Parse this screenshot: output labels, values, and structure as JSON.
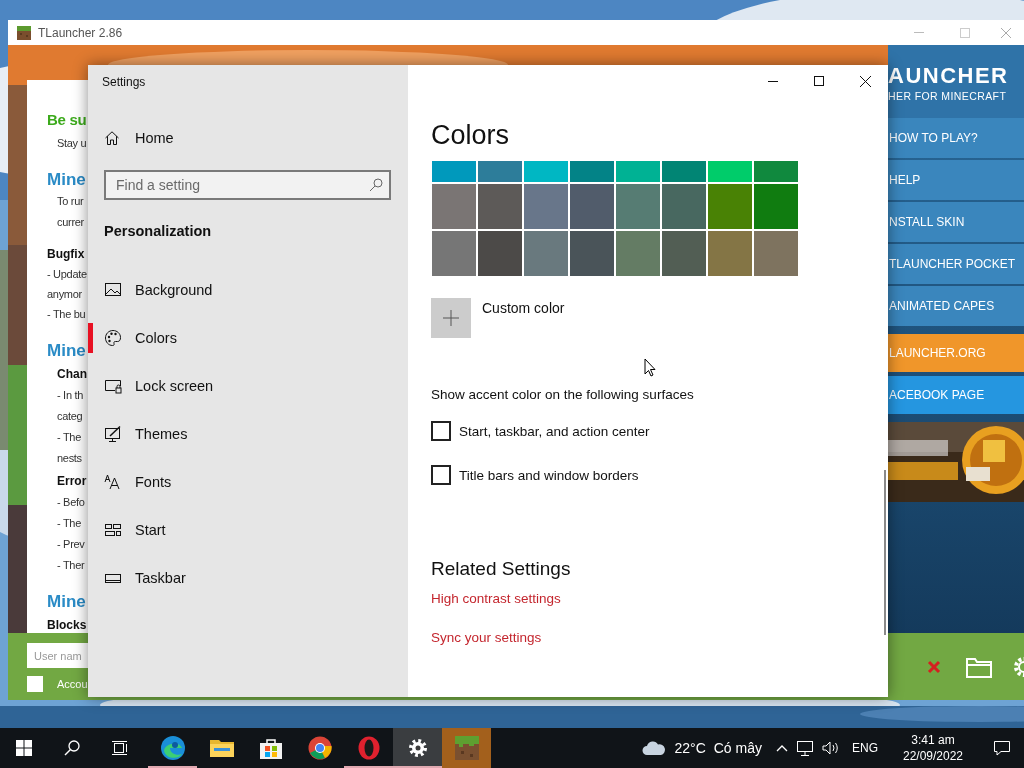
{
  "tlauncher": {
    "title": "TLauncher 2.86",
    "news": [
      {
        "kind": "title",
        "text": "Be su"
      },
      {
        "kind": "subline",
        "text": "Stay u"
      },
      {
        "kind": "heading",
        "text": "Mine"
      },
      {
        "kind": "subline",
        "text": "To rur"
      },
      {
        "kind": "subline",
        "text": "currer"
      },
      {
        "kind": "label",
        "text": "Bugfix"
      },
      {
        "kind": "line",
        "text": "- Update"
      },
      {
        "kind": "line",
        "text": "anymor"
      },
      {
        "kind": "line",
        "text": "- The bu"
      },
      {
        "kind": "heading",
        "text": "Mine"
      },
      {
        "kind": "sublabel",
        "text": "Chan"
      },
      {
        "kind": "subline",
        "text": "- In th"
      },
      {
        "kind": "subline",
        "text": "categ"
      },
      {
        "kind": "subline",
        "text": "- The"
      },
      {
        "kind": "subline",
        "text": "nests"
      },
      {
        "kind": "sublabel",
        "text": "Error"
      },
      {
        "kind": "subline",
        "text": "- Befo"
      },
      {
        "kind": "subline",
        "text": "- The"
      },
      {
        "kind": "subline",
        "text": "- Prev"
      },
      {
        "kind": "subline",
        "text": "- Ther"
      },
      {
        "kind": "heading",
        "text": "Mine"
      },
      {
        "kind": "label",
        "text": "Blocks"
      }
    ],
    "brand": {
      "title": "AUNCHER",
      "subtitle": "HER FOR MINECRAFT"
    },
    "menu": [
      {
        "kind": "menu",
        "label": "HOW TO PLAY?"
      },
      {
        "kind": "menu",
        "label": "HELP"
      },
      {
        "kind": "menu",
        "label": "NSTALL SKIN"
      },
      {
        "kind": "menu",
        "label": "TLAUNCHER POCKET"
      },
      {
        "kind": "menu",
        "label": "ANIMATED CAPES"
      },
      {
        "kind": "site",
        "label": "LAUNCHER.ORG"
      },
      {
        "kind": "social",
        "label": "ACEBOOK PAGE"
      }
    ],
    "username": {
      "placeholder": "User nam"
    },
    "account": {
      "label": "Accou",
      "checked": false
    }
  },
  "settings": {
    "title": "Settings",
    "home": "Home",
    "search": {
      "placeholder": "Find a setting"
    },
    "section": "Personalization",
    "nav": [
      {
        "kind": "background",
        "label": "Background",
        "selected": false
      },
      {
        "kind": "colors",
        "label": "Colors",
        "selected": true
      },
      {
        "kind": "lock-screen",
        "label": "Lock screen",
        "selected": false
      },
      {
        "kind": "themes",
        "label": "Themes",
        "selected": false
      },
      {
        "kind": "fonts",
        "label": "Fonts",
        "selected": false
      },
      {
        "kind": "start",
        "label": "Start",
        "selected": false
      },
      {
        "kind": "taskbar",
        "label": "Taskbar",
        "selected": false
      }
    ],
    "heading": "Colors",
    "swatches": [
      [
        {
          "color": "#0099bc",
          "selected": false
        },
        {
          "color": "#2d7d9a",
          "selected": false
        },
        {
          "color": "#00b7c3",
          "selected": false
        },
        {
          "color": "#038387",
          "selected": false
        },
        {
          "color": "#00b294",
          "selected": false
        },
        {
          "color": "#018574",
          "selected": false
        },
        {
          "color": "#00cc6a",
          "selected": false
        },
        {
          "color": "#10893e",
          "selected": false
        }
      ],
      [
        {
          "color": "#7a7574",
          "selected": false
        },
        {
          "color": "#5d5a58",
          "selected": false
        },
        {
          "color": "#68768a",
          "selected": false
        },
        {
          "color": "#515c6b",
          "selected": false
        },
        {
          "color": "#567c73",
          "selected": false
        },
        {
          "color": "#486860",
          "selected": false
        },
        {
          "color": "#498205",
          "selected": false
        },
        {
          "color": "#107c10",
          "selected": false
        }
      ],
      [
        {
          "color": "#767676",
          "selected": false
        },
        {
          "color": "#4c4a48",
          "selected": false
        },
        {
          "color": "#69797e",
          "selected": false
        },
        {
          "color": "#4a5459",
          "selected": false
        },
        {
          "color": "#647c64",
          "selected": false
        },
        {
          "color": "#525e54",
          "selected": false
        },
        {
          "color": "#847545",
          "selected": false
        },
        {
          "color": "#7e735f",
          "selected": false
        }
      ]
    ],
    "custom_color": "Custom color",
    "surfaces_title": "Show accent color on the following surfaces",
    "surfaces": [
      {
        "label": "Start, taskbar, and action center",
        "checked": false
      },
      {
        "label": "Title bars and window borders",
        "checked": false
      }
    ],
    "related_title": "Related Settings",
    "links": [
      "High contrast settings",
      "Sync your settings"
    ]
  },
  "taskbar": {
    "buttons": [
      {
        "kind": "start"
      },
      {
        "kind": "search"
      },
      {
        "kind": "task-view"
      }
    ],
    "apps": [
      {
        "kind": "edge",
        "running": true,
        "selected": false,
        "attention": false
      },
      {
        "kind": "explorer",
        "running": false,
        "selected": false,
        "attention": false
      },
      {
        "kind": "store",
        "running": false,
        "selected": false,
        "attention": false
      },
      {
        "kind": "chrome",
        "running": false,
        "selected": false,
        "attention": false
      },
      {
        "kind": "opera",
        "running": true,
        "selected": false,
        "attention": false
      },
      {
        "kind": "settings",
        "running": true,
        "selected": true,
        "attention": false
      },
      {
        "kind": "tlauncher",
        "running": false,
        "selected": false,
        "attention": true
      }
    ],
    "weather": {
      "temperature": "22°C",
      "condition": "Có mây"
    },
    "language": "ENG",
    "time": "3:41 am",
    "date": "22/09/2022"
  }
}
